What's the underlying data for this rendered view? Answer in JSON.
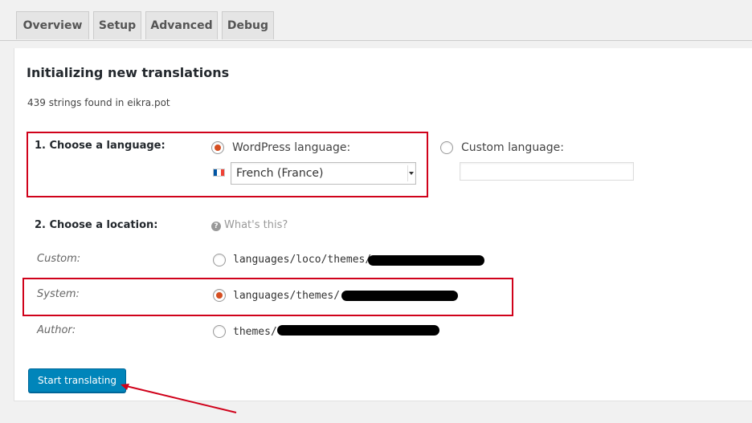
{
  "tabs": [
    {
      "label": "Overview"
    },
    {
      "label": "Setup"
    },
    {
      "label": "Advanced"
    },
    {
      "label": "Debug"
    }
  ],
  "panel": {
    "title": "Initializing new translations",
    "info": "439 strings found in eikra.pot",
    "language": {
      "label": "1. Choose a language:",
      "wp_option_label": "WordPress language:",
      "wp_selected": true,
      "selected_language": "French (France)",
      "flag_colors": [
        "#0055a4",
        "#ffffff",
        "#ef4135"
      ],
      "custom_option_label": "Custom language:",
      "custom_value": ""
    },
    "location": {
      "label": "2. Choose a location:",
      "help_icon": "question-circle-icon",
      "help_text": "What's this?",
      "options": [
        {
          "label": "Custom:",
          "path": "languages/loco/themes/",
          "selected": false
        },
        {
          "label": "System:",
          "path": "languages/themes/",
          "selected": true
        },
        {
          "label": "Author:",
          "path": "themes/",
          "selected": false
        }
      ]
    },
    "submit_label": "Start translating"
  },
  "colors": {
    "accent": "#0085ba",
    "radio_checked": "#d54e21",
    "highlight": "#d0021b"
  }
}
